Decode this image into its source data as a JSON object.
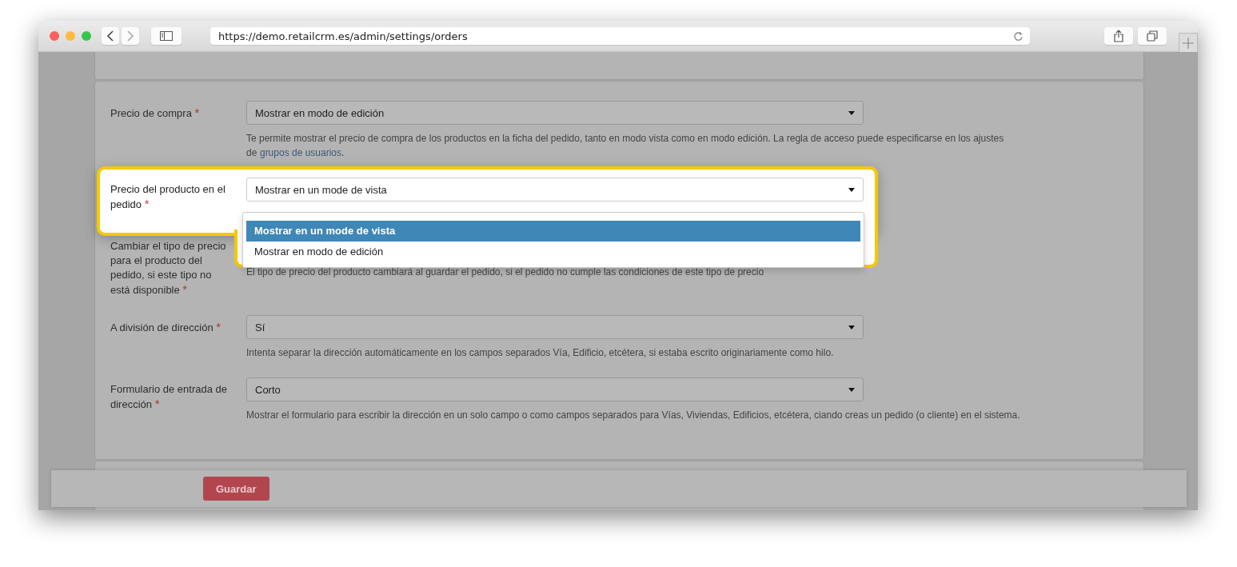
{
  "browser": {
    "url": "https://demo.retailcrm.es/admin/settings/orders"
  },
  "fields": [
    {
      "label": "Precio de compra",
      "required_mark": "*",
      "value": "Mostrar en modo de edición",
      "description": "Te permite mostrar el precio de compra de los productos en la ficha del pedido, tanto en modo vista como en modo edición. La regla de acceso puede especificarse en los ajustes de",
      "link": "grupos de usuarios",
      "after_link": ".",
      "highlighted": false
    },
    {
      "label": "Precio del producto en el pedido",
      "required_mark": "*",
      "value": "Mostrar en un mode de vista",
      "highlighted": true,
      "options": [
        {
          "label": "Mostrar en un mode de vista",
          "selected": true
        },
        {
          "label": "Mostrar en modo de edición",
          "selected": false
        }
      ]
    },
    {
      "label": "Cambiar el tipo de precio para el producto del pedido, si este tipo no está disponible",
      "required_mark": "*",
      "description": "El tipo de precio del producto cambiará al guardar el pedido, si el pedido no cumple las condiciones de este tipo de precio",
      "highlighted": false
    },
    {
      "label": "A división de dirección",
      "required_mark": "*",
      "value": "Sí",
      "description": "Intenta separar la dirección automáticamente en los campos separados Vía, Edificio, etcétera, si estaba escrito originariamente como hilo.",
      "highlighted": false
    },
    {
      "label": "Formulario de entrada de dirección",
      "required_mark": "*",
      "value": "Corto",
      "description": "Mostrar el formulario para escribir la dirección en un solo campo o como campos separados para Vías, Viviendas, Edificios, etcétera, ciando creas un pedido (o cliente) en el sistema.",
      "highlighted": false
    }
  ],
  "save_button": "Guardar"
}
